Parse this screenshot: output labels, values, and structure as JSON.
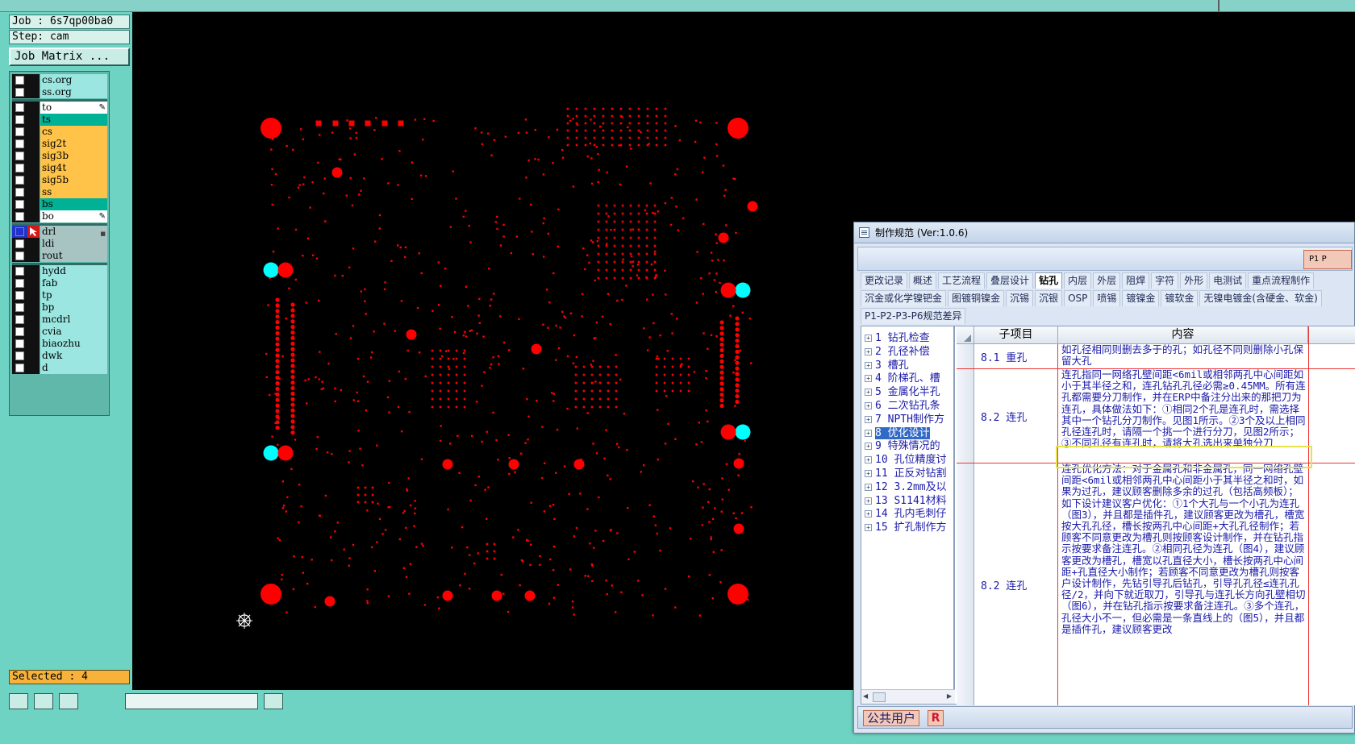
{
  "job": {
    "label": "Job : 6s7qp00ba0",
    "step": "Step: cam",
    "matrix_button": "Job Matrix ..."
  },
  "layers": [
    {
      "name": "cs.org",
      "color": "board",
      "group": 0
    },
    {
      "name": "ss.org",
      "color": "board",
      "group": 0
    },
    {
      "name": "to",
      "color": "white",
      "group": 1,
      "mark": "pen"
    },
    {
      "name": "ts",
      "color": "green",
      "group": 1
    },
    {
      "name": "cs",
      "color": "orange",
      "group": 1
    },
    {
      "name": "sig2t",
      "color": "orange",
      "group": 1
    },
    {
      "name": "sig3b",
      "color": "orange",
      "group": 1
    },
    {
      "name": "sig4t",
      "color": "orange",
      "group": 1
    },
    {
      "name": "sig5b",
      "color": "orange",
      "group": 1
    },
    {
      "name": "ss",
      "color": "orange",
      "group": 1
    },
    {
      "name": "bs",
      "color": "green",
      "group": 1
    },
    {
      "name": "bo",
      "color": "white",
      "group": 1,
      "mark": "pen"
    },
    {
      "name": "drl",
      "color": "drill",
      "group": 2,
      "active": true
    },
    {
      "name": "ldi",
      "color": "drill",
      "group": 2
    },
    {
      "name": "rout",
      "color": "drill",
      "group": 2
    },
    {
      "name": "hydd",
      "color": "doc",
      "group": 3
    },
    {
      "name": "fab",
      "color": "doc",
      "group": 3
    },
    {
      "name": "tp",
      "color": "doc",
      "group": 3
    },
    {
      "name": "bp",
      "color": "doc",
      "group": 3
    },
    {
      "name": "mcdrl",
      "color": "doc",
      "group": 3
    },
    {
      "name": "cvia",
      "color": "doc",
      "group": 3
    },
    {
      "name": "biaozhu",
      "color": "doc",
      "group": 3
    },
    {
      "name": "dwk",
      "color": "doc",
      "group": 3
    },
    {
      "name": "d",
      "color": "doc",
      "group": 3
    }
  ],
  "selected": "Selected : 4",
  "colors": {
    "panel": "#6fd3c3",
    "canvas": "#000000",
    "drill": "#ff0000",
    "selected_hole": "#00ffff",
    "highlight": "#e6e24a"
  },
  "spec": {
    "title": "制作规范 (Ver:1.0.6)",
    "page_toggles": "P1  P",
    "tabs_row1": [
      "更改记录",
      "概述",
      "工艺流程",
      "叠层设计",
      "钻孔",
      "内层",
      "外层",
      "阻焊",
      "字符",
      "外形",
      "电测试",
      "重点流程制作"
    ],
    "active_tab": "钻孔",
    "tabs_row2": [
      "沉金或化学镍钯金",
      "图镀铜镍金",
      "沉锡",
      "沉银",
      "OSP",
      "喷锡",
      "镀镍金",
      "镀软金",
      "无镍电镀金(含硬金、软金)"
    ],
    "tabs_row3": [
      "P1-P2-P3-P6规范差异"
    ],
    "tree": [
      {
        "num": "1",
        "label": "钻孔检查"
      },
      {
        "num": "2",
        "label": "孔径补偿"
      },
      {
        "num": "3",
        "label": "槽孔"
      },
      {
        "num": "4",
        "label": "阶梯孔、槽"
      },
      {
        "num": "5",
        "label": "金属化半孔"
      },
      {
        "num": "6",
        "label": "二次钻孔条"
      },
      {
        "num": "7",
        "label": "NPTH制作方"
      },
      {
        "num": "8",
        "label": "优化设计",
        "selected": true
      },
      {
        "num": "9",
        "label": "特殊情况的"
      },
      {
        "num": "10",
        "label": "孔位精度讨"
      },
      {
        "num": "11",
        "label": "正反对钻割"
      },
      {
        "num": "12",
        "label": "3.2mm及以"
      },
      {
        "num": "13",
        "label": "S1141材料"
      },
      {
        "num": "14",
        "label": "孔内毛刺仔"
      },
      {
        "num": "15",
        "label": "扩孔制作方"
      }
    ],
    "grid_headers": [
      "子项目",
      "内容"
    ],
    "rows": [
      {
        "sub": "8.1 重孔",
        "content": "如孔径相同则删去多于的孔；如孔径不同则删除小孔保留大孔"
      },
      {
        "sub": "8.2 连孔",
        "content": "连孔指同一网络孔壁间距<6mil或相邻两孔中心间距如小于其半径之和，连孔钻孔孔径必需≥0.45MM。所有连孔都需要分刀制作，并在ERP中备注分出来的那把刀为连孔，具体做法如下：①相同2个孔是连孔时，需选择其中一个钻孔分刀制作。见图1所示。②3个及以上相同孔径连孔时，请隔一个挑一个进行分刀，见图2所示；③不同孔径有连孔时，请将大孔选出来单独分刀"
      },
      {
        "sub": "8.2 连孔",
        "content": "连孔优化方法：对于金属孔和非金属孔，同一网络孔壁间距<6mil或相邻两孔中心间距小于其半径之和时，如果为过孔，建议顾客删除多余的过孔（包括高频板）；如下设计建议客户优化：①1个大孔与一个小孔为连孔（图3），并且都是插件孔，建议顾客更改为槽孔，槽宽按大孔孔径，槽长按两孔中心间距+大孔孔径制作；若顾客不同意更改为槽孔则按顾客设计制作，并在钻孔指示按要求备注连孔。②相同孔径为连孔（图4），建议顾客更改为槽孔，槽宽以孔直径大小，槽长按两孔中心间距+孔直径大小制作；若顾客不同意更改为槽孔则按客户设计制作，先钻引导孔后钻孔，引导孔孔径≤连孔孔径/2，并向下就近取刀，引导孔与连孔长方向孔壁相切（图6），并在钻孔指示按要求备注连孔。③多个连孔，孔径大小不一，但必需是一条直线上的（图5），并且都是插件孔，建议顾客更改"
      }
    ],
    "status_user": "公共用户",
    "status_r": "R"
  }
}
